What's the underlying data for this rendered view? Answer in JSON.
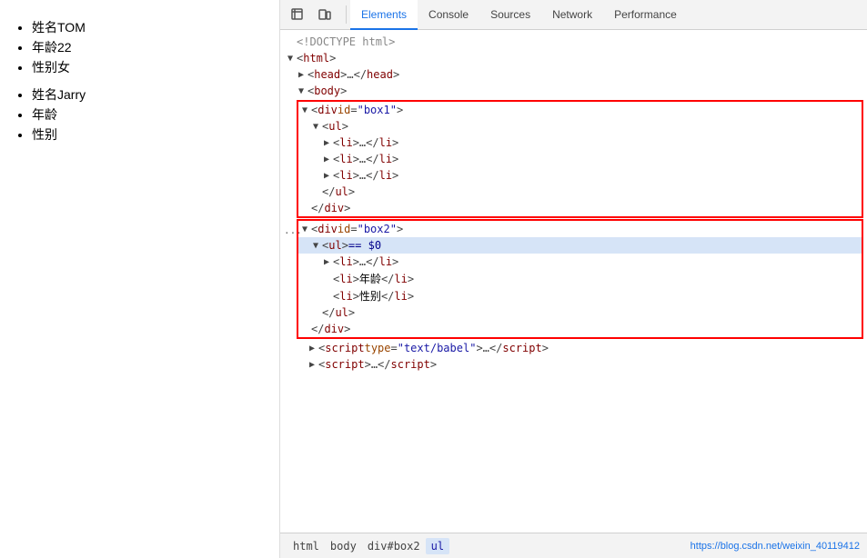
{
  "left": {
    "list1": [
      {
        "label": "姓名TOM"
      },
      {
        "label": "年龄22"
      },
      {
        "label": "性别女"
      }
    ],
    "list2": [
      {
        "label": "姓名Jarry"
      },
      {
        "label": "年龄"
      },
      {
        "label": "性别"
      }
    ]
  },
  "devtools": {
    "tabs": [
      {
        "id": "elements",
        "label": "Elements",
        "active": true
      },
      {
        "id": "console",
        "label": "Console",
        "active": false
      },
      {
        "id": "sources",
        "label": "Sources",
        "active": false
      },
      {
        "id": "network",
        "label": "Network",
        "active": false
      },
      {
        "id": "performance",
        "label": "Performance",
        "active": false
      }
    ],
    "lines": [
      {
        "indent": 0,
        "arrow": "none",
        "text_parts": [
          {
            "type": "comment",
            "text": "<!DOCTYPE html>"
          }
        ]
      },
      {
        "indent": 0,
        "arrow": "down",
        "text_parts": [
          {
            "type": "bracket",
            "text": "<"
          },
          {
            "type": "tag",
            "text": "html"
          },
          {
            "type": "bracket",
            "text": ">"
          }
        ]
      },
      {
        "indent": 1,
        "arrow": "right",
        "text_parts": [
          {
            "type": "bracket",
            "text": "<"
          },
          {
            "type": "tag",
            "text": "head"
          },
          {
            "type": "bracket",
            "text": ">…</"
          },
          {
            "type": "tag",
            "text": "head"
          },
          {
            "type": "bracket",
            "text": ">"
          }
        ]
      },
      {
        "indent": 1,
        "arrow": "down",
        "text_parts": [
          {
            "type": "bracket",
            "text": "<"
          },
          {
            "type": "tag",
            "text": "body"
          },
          {
            "type": "bracket",
            "text": ">"
          }
        ]
      },
      {
        "indent": 2,
        "arrow": "down",
        "text_parts": [
          {
            "type": "bracket",
            "text": "<"
          },
          {
            "type": "tag",
            "text": "div"
          },
          {
            "type": "bracket",
            "text": " "
          },
          {
            "type": "attr",
            "text": "id"
          },
          {
            "type": "bracket",
            "text": "="
          },
          {
            "type": "attrval",
            "text": "\"box1\""
          },
          {
            "type": "bracket",
            "text": ">"
          }
        ],
        "box_start": true,
        "box_id": 1
      },
      {
        "indent": 3,
        "arrow": "down",
        "text_parts": [
          {
            "type": "bracket",
            "text": "<"
          },
          {
            "type": "tag",
            "text": "ul"
          },
          {
            "type": "bracket",
            "text": ">"
          }
        ]
      },
      {
        "indent": 4,
        "arrow": "right",
        "text_parts": [
          {
            "type": "bracket",
            "text": "<"
          },
          {
            "type": "tag",
            "text": "li"
          },
          {
            "type": "bracket",
            "text": ">…</"
          },
          {
            "type": "tag",
            "text": "li"
          },
          {
            "type": "bracket",
            "text": ">"
          }
        ]
      },
      {
        "indent": 4,
        "arrow": "right",
        "text_parts": [
          {
            "type": "bracket",
            "text": "<"
          },
          {
            "type": "tag",
            "text": "li"
          },
          {
            "type": "bracket",
            "text": ">…</"
          },
          {
            "type": "tag",
            "text": "li"
          },
          {
            "type": "bracket",
            "text": ">"
          }
        ]
      },
      {
        "indent": 4,
        "arrow": "right",
        "text_parts": [
          {
            "type": "bracket",
            "text": "<"
          },
          {
            "type": "tag",
            "text": "li"
          },
          {
            "type": "bracket",
            "text": ">…</"
          },
          {
            "type": "tag",
            "text": "li"
          },
          {
            "type": "bracket",
            "text": ">"
          }
        ]
      },
      {
        "indent": 3,
        "arrow": "none",
        "text_parts": [
          {
            "type": "bracket",
            "text": "</"
          },
          {
            "type": "tag",
            "text": "ul"
          },
          {
            "type": "bracket",
            "text": ">"
          }
        ]
      },
      {
        "indent": 2,
        "arrow": "none",
        "text_parts": [
          {
            "type": "bracket",
            "text": "</"
          },
          {
            "type": "tag",
            "text": "div"
          },
          {
            "type": "bracket",
            "text": ">"
          }
        ],
        "box_end": true,
        "box_id": 1
      },
      {
        "indent": 2,
        "arrow": "down",
        "text_parts": [
          {
            "type": "bracket",
            "text": "<"
          },
          {
            "type": "tag",
            "text": "div"
          },
          {
            "type": "bracket",
            "text": " "
          },
          {
            "type": "attr",
            "text": "id"
          },
          {
            "type": "bracket",
            "text": "="
          },
          {
            "type": "attrval",
            "text": "\"box2\""
          },
          {
            "type": "bracket",
            "text": ">"
          }
        ],
        "box_start": true,
        "box_id": 2,
        "has_dots": true
      },
      {
        "indent": 3,
        "arrow": "down",
        "highlighted": true,
        "text_parts": [
          {
            "type": "bracket",
            "text": "<"
          },
          {
            "type": "tag",
            "text": "ul"
          },
          {
            "type": "bracket",
            "text": ">"
          },
          {
            "type": "eq",
            "text": " == $0"
          }
        ]
      },
      {
        "indent": 4,
        "arrow": "right",
        "text_parts": [
          {
            "type": "bracket",
            "text": "<"
          },
          {
            "type": "tag",
            "text": "li"
          },
          {
            "type": "bracket",
            "text": ">…</"
          },
          {
            "type": "tag",
            "text": "li"
          },
          {
            "type": "bracket",
            "text": ">"
          }
        ]
      },
      {
        "indent": 4,
        "arrow": "none",
        "text_parts": [
          {
            "type": "bracket",
            "text": "<"
          },
          {
            "type": "tag",
            "text": "li"
          },
          {
            "type": "bracket",
            "text": ">"
          },
          {
            "type": "text",
            "text": "年龄"
          },
          {
            "type": "bracket",
            "text": "</"
          },
          {
            "type": "tag",
            "text": "li"
          },
          {
            "type": "bracket",
            "text": ">"
          }
        ]
      },
      {
        "indent": 4,
        "arrow": "none",
        "text_parts": [
          {
            "type": "bracket",
            "text": "<"
          },
          {
            "type": "tag",
            "text": "li"
          },
          {
            "type": "bracket",
            "text": ">"
          },
          {
            "type": "text",
            "text": "性别"
          },
          {
            "type": "bracket",
            "text": "</"
          },
          {
            "type": "tag",
            "text": "li"
          },
          {
            "type": "bracket",
            "text": ">"
          }
        ]
      },
      {
        "indent": 3,
        "arrow": "none",
        "text_parts": [
          {
            "type": "bracket",
            "text": "</"
          },
          {
            "type": "tag",
            "text": "ul"
          },
          {
            "type": "bracket",
            "text": ">"
          }
        ]
      },
      {
        "indent": 2,
        "arrow": "none",
        "text_parts": [
          {
            "type": "bracket",
            "text": "</"
          },
          {
            "type": "tag",
            "text": "div"
          },
          {
            "type": "bracket",
            "text": ">"
          }
        ],
        "box_end": true,
        "box_id": 2
      },
      {
        "indent": 2,
        "arrow": "right",
        "text_parts": [
          {
            "type": "bracket",
            "text": "<"
          },
          {
            "type": "tag",
            "text": "script"
          },
          {
            "type": "bracket",
            "text": " "
          },
          {
            "type": "attr",
            "text": "type"
          },
          {
            "type": "bracket",
            "text": "="
          },
          {
            "type": "attrval",
            "text": "\"text/babel\""
          },
          {
            "type": "bracket",
            "text": ">…</"
          },
          {
            "type": "tag",
            "text": "script"
          },
          {
            "type": "bracket",
            "text": ">"
          }
        ]
      },
      {
        "indent": 2,
        "arrow": "right",
        "text_parts": [
          {
            "type": "bracket",
            "text": "<"
          },
          {
            "type": "tag",
            "text": "script"
          },
          {
            "type": "bracket",
            "text": ">…</"
          },
          {
            "type": "tag",
            "text": "script"
          },
          {
            "type": "bracket",
            "text": ">"
          }
        ]
      }
    ],
    "breadcrumbs": [
      "html",
      "body",
      "div#box2",
      "ul"
    ],
    "url": "https://blog.csdn.net/weixin_40119412"
  }
}
